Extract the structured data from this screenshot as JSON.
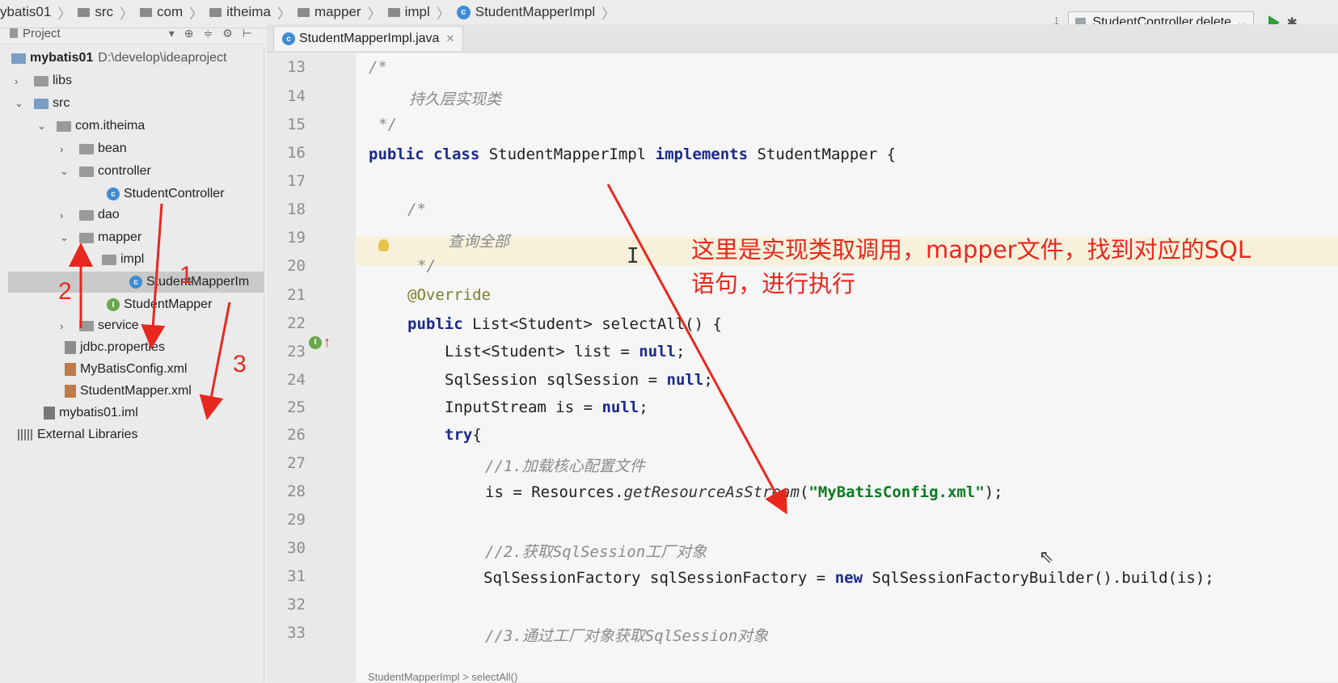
{
  "breadcrumb": [
    "ybatis01",
    "src",
    "com",
    "itheima",
    "mapper",
    "impl",
    "StudentMapperImpl"
  ],
  "toolbar": {
    "run_config": "StudentController.delete"
  },
  "project_panel": {
    "title": "Project",
    "tree": [
      {
        "label": "mybatis01",
        "path": "D:\\develop\\ideaproject"
      },
      {
        "label": "libs"
      },
      {
        "label": "src"
      },
      {
        "label": "com.itheima"
      },
      {
        "label": "bean"
      },
      {
        "label": "controller"
      },
      {
        "label": "StudentController"
      },
      {
        "label": "dao"
      },
      {
        "label": "mapper"
      },
      {
        "label": "impl"
      },
      {
        "label": "StudentMapperIm"
      },
      {
        "label": "StudentMapper"
      },
      {
        "label": "service"
      },
      {
        "label": "jdbc.properties"
      },
      {
        "label": "MyBatisConfig.xml"
      },
      {
        "label": "StudentMapper.xml"
      },
      {
        "label": "mybatis01.iml"
      },
      {
        "label": "External Libraries"
      }
    ],
    "annotations": {
      "n1": "1",
      "n2": "2",
      "n3": "3"
    }
  },
  "editor": {
    "tab_label": "StudentMapperImpl.java",
    "line_numbers": [
      "13",
      "14",
      "15",
      "16",
      "17",
      "18",
      "19",
      "20",
      "21",
      "22",
      "23",
      "24",
      "25",
      "26",
      "27",
      "28",
      "29",
      "30",
      "31",
      "32",
      "33"
    ],
    "code": {
      "l13": "/*",
      "l14": "持久层实现类",
      "l15": "*/",
      "l16_kw": "public class",
      "l16_a": " StudentMapperImpl ",
      "l16_kw2": "implements",
      "l16_b": " StudentMapper {",
      "l18": "/*",
      "l19": "查询全部",
      "l20": "*/",
      "l21": "@Override",
      "l22_kw": "public",
      "l22_a": " List<Student> selectAll() {",
      "l23_a": "List<Student> list = ",
      "l23_kw": "null",
      "l23_b": ";",
      "l24_a": "SqlSession sqlSession = ",
      "l24_kw": "null",
      "l24_b": ";",
      "l25_a": "InputStream is = ",
      "l25_kw": "null",
      "l25_b": ";",
      "l26_kw": "try",
      "l26_a": "{",
      "l27": "//1.加载核心配置文件",
      "l28_a": "is = Resources.",
      "l28_it": "getResourceAsStream",
      "l28_b": "(",
      "l28_str": "\"MyBatisConfig.xml\"",
      "l28_c": ");",
      "l30": "//2.获取SqlSession工厂对象",
      "l31_a": "SqlSessionFactory sqlSessionFactory = ",
      "l31_kw": "new",
      "l31_b": " SqlSessionFactoryBuilder().build(is);",
      "l33": "//3.通过工厂对象获取SqlSession对象"
    },
    "note": "这里是实现类取调用，mapper文件，找到对应的SQL语句，进行执行",
    "status_path": "StudentMapperImpl > selectAll()"
  },
  "colors": {
    "annotation_red": "#e8281e",
    "keyword": "#1a2a8c",
    "comment": "#8a8a8a"
  }
}
